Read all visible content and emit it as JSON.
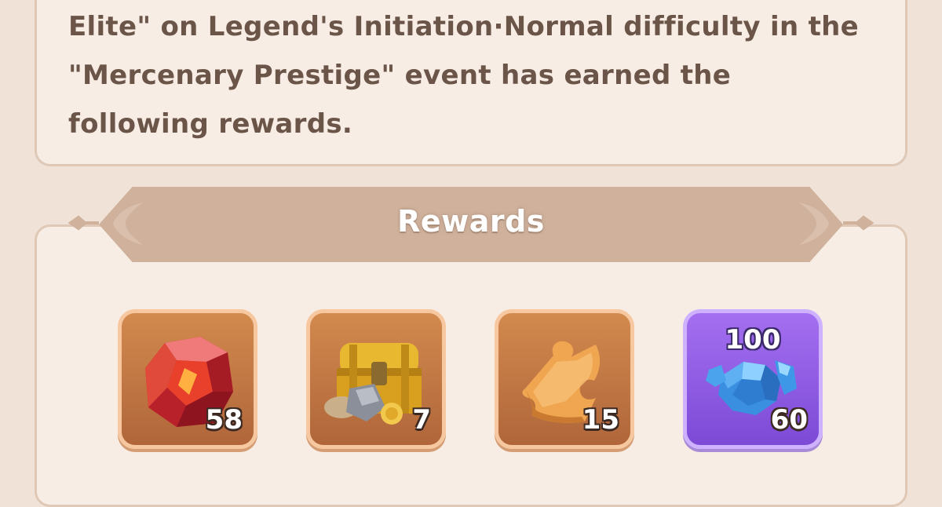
{
  "message": {
    "text": "Elite\" on Legend's Initiation·Normal difficulty in the \"Mercenary Prestige\" event has earned the following rewards."
  },
  "rewards": {
    "title": "Rewards",
    "items": [
      {
        "icon": "red-crystal-icon",
        "quantity": "58",
        "style": "orange"
      },
      {
        "icon": "treasure-chest-icon",
        "quantity": "7",
        "style": "orange"
      },
      {
        "icon": "puzzle-piece-icon",
        "quantity": "15",
        "style": "orange"
      },
      {
        "icon": "blue-gem-icon",
        "quantity": "60",
        "top_label": "100",
        "style": "purple"
      }
    ]
  },
  "colors": {
    "background": "#f0e2d6",
    "panel": "#f8ede5",
    "ribbon": "#cfb19c",
    "text": "#6b5548",
    "slot_orange": "#c8783f",
    "slot_purple": "#9a63ea"
  }
}
